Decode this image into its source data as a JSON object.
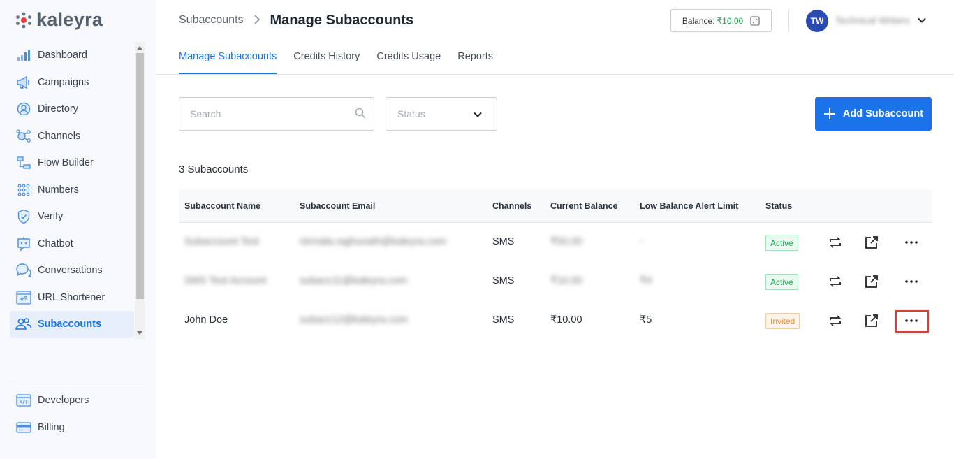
{
  "brand": {
    "name": "kaleyra"
  },
  "sidebar": {
    "items": [
      {
        "label": "Dashboard",
        "icon": "bar-chart-icon"
      },
      {
        "label": "Campaigns",
        "icon": "megaphone-icon"
      },
      {
        "label": "Directory",
        "icon": "user-circle-icon"
      },
      {
        "label": "Channels",
        "icon": "channels-icon"
      },
      {
        "label": "Flow Builder",
        "icon": "flow-icon"
      },
      {
        "label": "Numbers",
        "icon": "dial-pad-icon"
      },
      {
        "label": "Verify",
        "icon": "shield-check-icon"
      },
      {
        "label": "Chatbot",
        "icon": "chatbot-icon"
      },
      {
        "label": "Conversations",
        "icon": "chat-bubbles-icon"
      },
      {
        "label": "URL Shortener",
        "icon": "link-icon"
      },
      {
        "label": "Subaccounts",
        "icon": "users-icon",
        "active": true
      }
    ],
    "bottom_items": [
      {
        "label": "Developers",
        "icon": "code-window-icon"
      },
      {
        "label": "Billing",
        "icon": "credit-card-icon"
      }
    ]
  },
  "header": {
    "breadcrumb_parent": "Subaccounts",
    "breadcrumb_current": "Manage Subaccounts",
    "balance_label": "Balance:",
    "balance_value": "₹10.00",
    "user_initials": "TW",
    "user_name": "Technical Writers"
  },
  "tabs": [
    {
      "label": "Manage Subaccounts",
      "active": true
    },
    {
      "label": "Credits History"
    },
    {
      "label": "Credits Usage"
    },
    {
      "label": "Reports"
    }
  ],
  "toolbar": {
    "search_placeholder": "Search",
    "status_placeholder": "Status",
    "add_button": "Add Subaccount"
  },
  "count_label": "3 Subaccounts",
  "table": {
    "columns": [
      "Subaccount Name",
      "Subaccount Email",
      "Channels",
      "Current Balance",
      "Low Balance Alert Limit",
      "Status"
    ],
    "rows": [
      {
        "name": "Subaccount Test",
        "email": "nirmala.raghunath@kaleyra.com",
        "channels": "SMS",
        "balance": "₹50.00",
        "alert_limit": "-",
        "status": "Active",
        "blurred": true
      },
      {
        "name": "SMS Test Account",
        "email": "subacc11@kaleyra.com",
        "channels": "SMS",
        "balance": "₹10.00",
        "alert_limit": "₹4",
        "status": "Active",
        "blurred": true
      },
      {
        "name": "John Doe",
        "email": "subacc12@kaleyra.com",
        "channels": "SMS",
        "balance": "₹10.00",
        "alert_limit": "₹5",
        "status": "Invited",
        "blurred": false
      }
    ]
  },
  "colors": {
    "accent": "#1a73e8",
    "active_status": "#22a35a",
    "invited_status": "#e8903a",
    "highlight": "#e03b3b"
  }
}
